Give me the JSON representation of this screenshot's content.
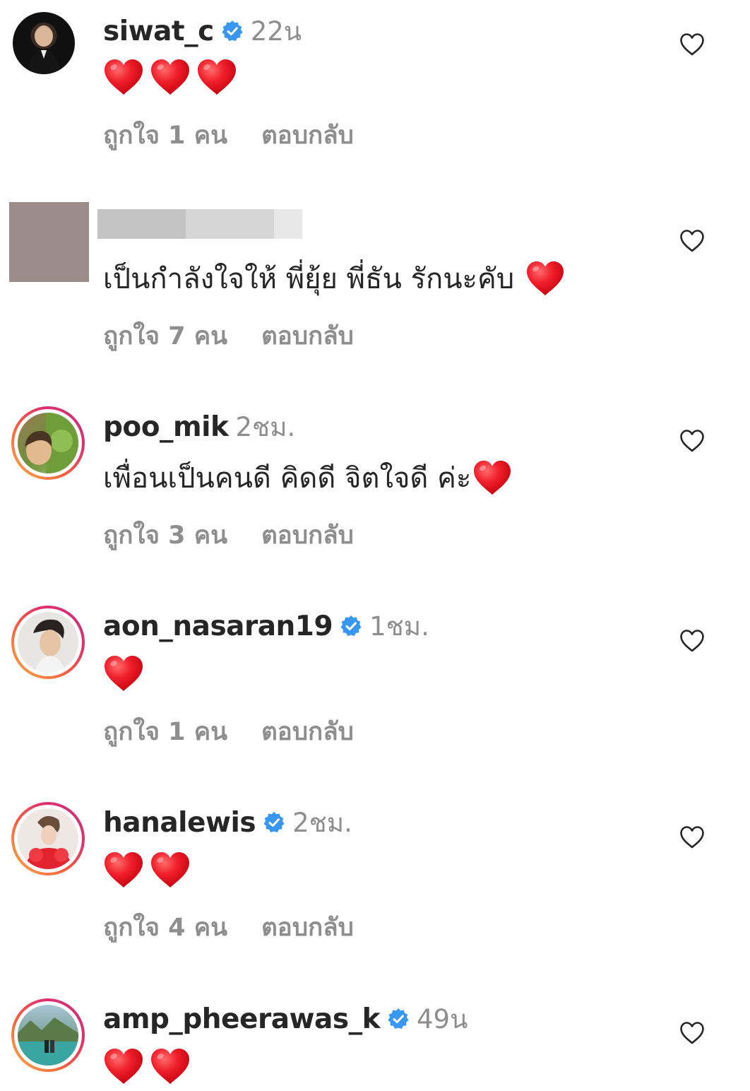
{
  "like_label_prefix": "ถูกใจ",
  "like_label_suffix": "คน",
  "reply_label": "ตอบกลับ",
  "colors": {
    "text": "#262626",
    "secondary": "#8e8e8e",
    "verified": "#3897f0",
    "heart": "#e8131f"
  },
  "comments": [
    {
      "username": "siwat_c",
      "verified": true,
      "time": "22น",
      "text": "",
      "hearts": 3,
      "likes": "1",
      "avatar_ring": false
    },
    {
      "username": "",
      "verified": false,
      "time": "",
      "text": "เป็นกำลังใจให้ พี่ยุ้ย พี่ธัน รักนะคับ",
      "hearts": 1,
      "likes": "7",
      "avatar_ring": false
    },
    {
      "username": "poo_mik",
      "verified": false,
      "time": "2ชม.",
      "text": "เพื่อนเป็นคนดี คิดดี จิตใจดี ค่ะ",
      "hearts": 1,
      "likes": "3",
      "avatar_ring": true
    },
    {
      "username": "aon_nasaran19",
      "verified": true,
      "time": "1ชม.",
      "text": "",
      "hearts": 1,
      "likes": "1",
      "avatar_ring": true
    },
    {
      "username": "hanalewis",
      "verified": true,
      "time": "2ชม.",
      "text": "",
      "hearts": 2,
      "likes": "4",
      "avatar_ring": true
    },
    {
      "username": "amp_pheerawas_k",
      "verified": true,
      "time": "49น",
      "text": "",
      "hearts": 2,
      "likes": "",
      "avatar_ring": true
    }
  ]
}
